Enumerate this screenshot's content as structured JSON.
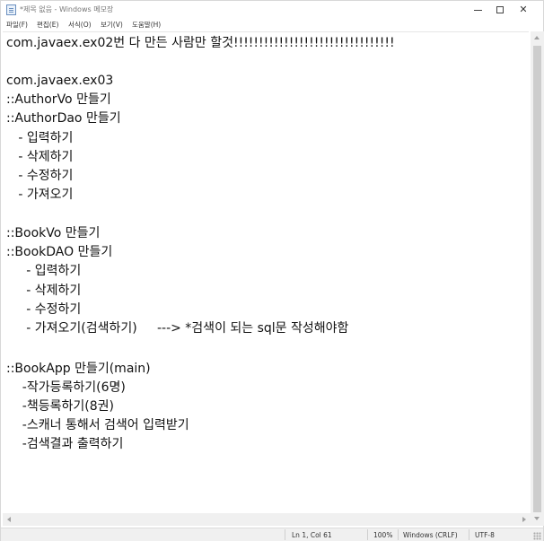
{
  "window": {
    "title": "*제목 없음 - Windows 메모장",
    "minimize_icon": "minimize-icon",
    "maximize_icon": "maximize-icon",
    "close_icon": "close-icon",
    "close_label": "✕"
  },
  "menu": {
    "items": [
      {
        "label": "파일(F)"
      },
      {
        "label": "편집(E)"
      },
      {
        "label": "서식(O)"
      },
      {
        "label": "보기(V)"
      },
      {
        "label": "도움말(H)"
      }
    ]
  },
  "editor": {
    "lines": [
      "com.javaex.ex02번 다 만든 사람만 할것!!!!!!!!!!!!!!!!!!!!!!!!!!!!!!!!",
      "",
      "com.javaex.ex03",
      "::AuthorVo 만들기",
      "::AuthorDao 만들기",
      "   - 입력하기",
      "   - 삭제하기",
      "   - 수정하기",
      "   - 가져오기",
      "",
      "",
      "::BookVo 만들기",
      "::BookDAO 만들기",
      "     - 입력하기",
      "     - 삭제하기",
      "     - 수정하기",
      "     - 가져오기(검색하기)     ---> *검색이 되는 sql문 작성해야함",
      "",
      "::BookApp 만들기(main)",
      "    -작가등록하기(6명)",
      "    -책등록하기(8권)",
      "    -스캐너 통해서 검색어 입력받기",
      "    -검색결과 출력하기"
    ]
  },
  "statusbar": {
    "position": "Ln 1, Col 61",
    "zoom": "100%",
    "line_ending": "Windows (CRLF)",
    "encoding": "UTF-8"
  }
}
